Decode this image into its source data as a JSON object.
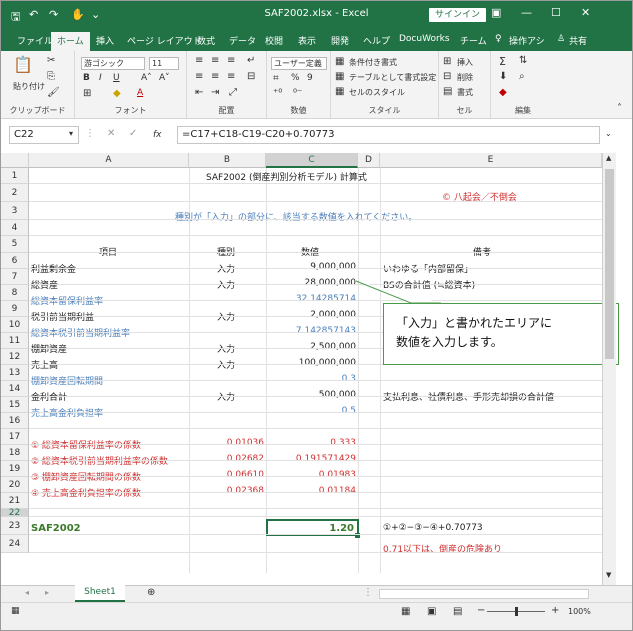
{
  "window": {
    "title": "SAF2002.xlsx - Excel",
    "signin": "サインイン"
  },
  "quick_access": {
    "save_icon": "save-icon",
    "undo_icon": "undo-icon",
    "redo_icon": "redo-icon"
  },
  "tabs": [
    "ファイル",
    "ホーム",
    "挿入",
    "ページ レイアウト",
    "数式",
    "データ",
    "校閲",
    "表示",
    "開発",
    "ヘルプ",
    "DocuWorks",
    "チーム",
    "操作アシ",
    "共有"
  ],
  "ribbon": {
    "clipboard": {
      "paste": "貼り付け",
      "label": "クリップボード"
    },
    "font": {
      "name": "游ゴシック",
      "size": "11",
      "label": "フォント",
      "bold": "B",
      "italic": "I",
      "underline": "U",
      "grow": "A˄",
      "shrink": "A˅",
      "color": "A"
    },
    "align": {
      "label": "配置"
    },
    "number": {
      "format": "ユーザー定義",
      "currency": "",
      "percent": "%",
      "comma": "9",
      "label": "数値"
    },
    "styles": {
      "cond": "条件付き書式",
      "table": "テーブルとして書式設定",
      "cell": "セルのスタイル",
      "label": "スタイル"
    },
    "cells": {
      "insert": "挿入",
      "delete": "削除",
      "format": "書式",
      "label": "セル"
    },
    "edit": {
      "sum": "Σ",
      "label": "編集"
    }
  },
  "formula_bar": {
    "name_box": "C22",
    "formula": "=C17+C18-C19-C20+0.70773",
    "fx": "fx"
  },
  "columns": [
    "A",
    "B",
    "C",
    "D",
    "E"
  ],
  "rows": [
    "1",
    "2",
    "3",
    "4",
    "5",
    "6",
    "7",
    "8",
    "9",
    "10",
    "11",
    "12",
    "13",
    "14",
    "15",
    "16",
    "17",
    "18",
    "19",
    "20",
    "21",
    "22",
    "23",
    "24"
  ],
  "cells": {
    "r1": {
      "b": "SAF2002 (倒産判別分析モデル) 計算式"
    },
    "r2": {
      "e": "© 八起会／不倒会"
    },
    "r3": {
      "b": "種別が「入力」の部分に、該当する数値を入れてください。"
    },
    "r5": {
      "a": "項目",
      "b": "種別",
      "c": "数値",
      "e": "備考"
    },
    "r6": {
      "a": "利益剰余金",
      "b": "入力",
      "c": "9,000,000",
      "e": "いわゆる「内部留保」"
    },
    "r7": {
      "a": "総資産",
      "b": "入力",
      "c": "28,000,000",
      "e": "BSの合計值 (≒総資本)"
    },
    "r8": {
      "a": "総資本留保利益率",
      "c": "32.14285714"
    },
    "r9": {
      "a": "税引前当期利益",
      "b": "入力",
      "c": "2,000,000"
    },
    "r10": {
      "a": "総資本税引前当期利益率",
      "c": "7.142857143"
    },
    "r11": {
      "a": "棚卸資産",
      "b": "入力",
      "c": "2,500,000"
    },
    "r12": {
      "a": "売上高",
      "b": "入力",
      "c": "100,000,000"
    },
    "r13": {
      "a": "棚卸資産回転期間",
      "c": "0.3"
    },
    "r14": {
      "a": "金利合計",
      "b": "入力",
      "c": "500,000",
      "e": "支払利息、社債利息、手形売却損の合計値"
    },
    "r15": {
      "a": "売上高金利負担率",
      "c": "0.5"
    },
    "r17": {
      "a": "① 総資本留保利益率の係数",
      "b": "0.01036",
      "c": "0.333"
    },
    "r18": {
      "a": "② 総資本税引前当期利益率の係数",
      "b": "0.02682",
      "c": "0.191571429"
    },
    "r19": {
      "a": "③ 棚卸資産回転期間の係数",
      "b": "0.06610",
      "c": "0.01983"
    },
    "r20": {
      "a": "④ 売上高金利負担率の係数",
      "b": "0.02368",
      "c": "0.01184"
    },
    "r22": {
      "a": "SAF2002",
      "c": "1.20",
      "e": "①+②−③−④+0.70773"
    },
    "r23": {
      "e": "0.71以下は、倒産の危険あり"
    }
  },
  "callout": {
    "line1": "「入力」と書かれたエリアに",
    "line2": "数値を入力します。"
  },
  "sheet_tab": "Sheet1",
  "status": {
    "zoom": "100%"
  },
  "colors": {
    "accent": "#217346",
    "blue_text": "#4a7ebb",
    "red_text": "#d03030",
    "green_text": "#3b7a2a"
  }
}
